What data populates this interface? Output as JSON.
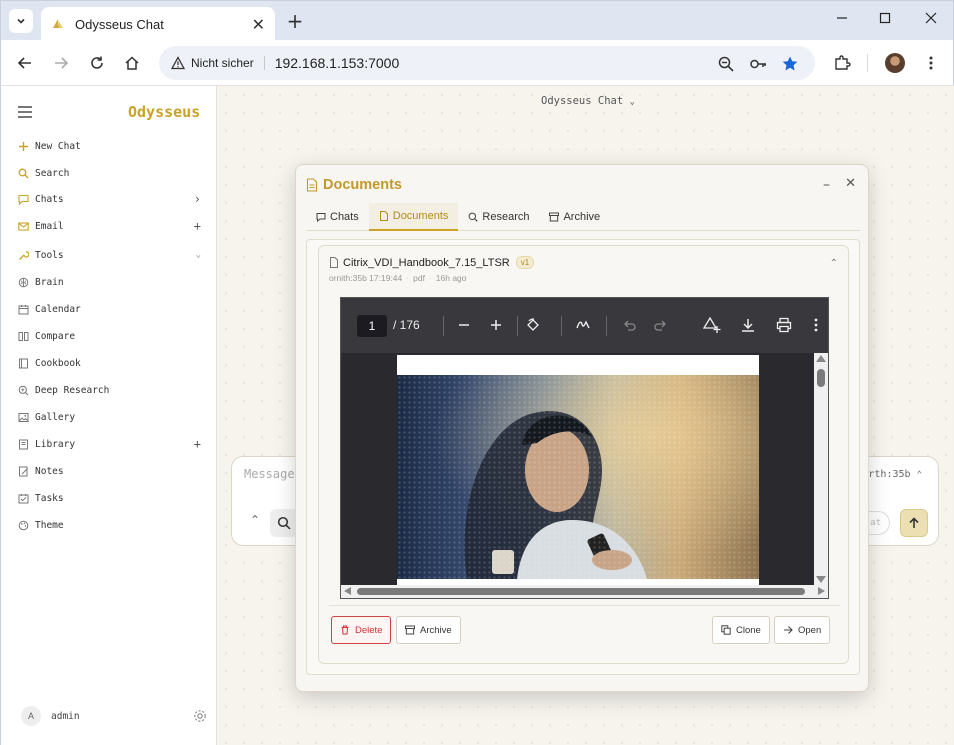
{
  "browser": {
    "tab_title": "Odysseus Chat",
    "security_label": "Nicht sicher",
    "url": "192.168.1.153:7000"
  },
  "sidebar": {
    "brand": "Odysseus",
    "items": [
      {
        "label": "New Chat",
        "icon": "plus-icon",
        "right": ""
      },
      {
        "label": "Search",
        "icon": "search-icon",
        "right": ""
      },
      {
        "label": "Chats",
        "icon": "chat-bubble-icon",
        "right": "›"
      },
      {
        "label": "Email",
        "icon": "envelope-icon",
        "right": "+"
      },
      {
        "label": "Tools",
        "icon": "wrench-icon",
        "right": "⌄"
      },
      {
        "label": "Brain",
        "icon": "brain-icon",
        "right": ""
      },
      {
        "label": "Calendar",
        "icon": "calendar-icon",
        "right": ""
      },
      {
        "label": "Compare",
        "icon": "columns-icon",
        "right": ""
      },
      {
        "label": "Cookbook",
        "icon": "book-icon",
        "right": ""
      },
      {
        "label": "Deep Research",
        "icon": "zoom-icon",
        "right": ""
      },
      {
        "label": "Gallery",
        "icon": "image-icon",
        "right": ""
      },
      {
        "label": "Library",
        "icon": "library-icon",
        "right": "+"
      },
      {
        "label": "Notes",
        "icon": "notes-icon",
        "right": ""
      },
      {
        "label": "Tasks",
        "icon": "tasks-icon",
        "right": ""
      },
      {
        "label": "Theme",
        "icon": "palette-icon",
        "right": ""
      }
    ],
    "user": {
      "initial": "A",
      "name": "admin"
    }
  },
  "main": {
    "title": "Odysseus Chat",
    "composer_placeholder": "Message",
    "model_label": "rth:35b",
    "chip_label": "at"
  },
  "modal": {
    "title": "Documents",
    "tabs": [
      {
        "label": "Chats",
        "active": false
      },
      {
        "label": "Documents",
        "active": true
      },
      {
        "label": "Research",
        "active": false
      },
      {
        "label": "Archive",
        "active": false
      }
    ],
    "document": {
      "name": "Citrix_VDI_Handbook_7.15_LTSR",
      "version": "v1",
      "author": "ornith:35b 17:19:44",
      "type": "pdf",
      "age": "16h ago"
    },
    "pdf": {
      "current_page": "1",
      "total_pages": "/ 176"
    },
    "actions": {
      "delete": "Delete",
      "archive": "Archive",
      "clone": "Clone",
      "open": "Open"
    }
  },
  "colors": {
    "accent": "#c9a227",
    "danger": "#cc3333"
  }
}
